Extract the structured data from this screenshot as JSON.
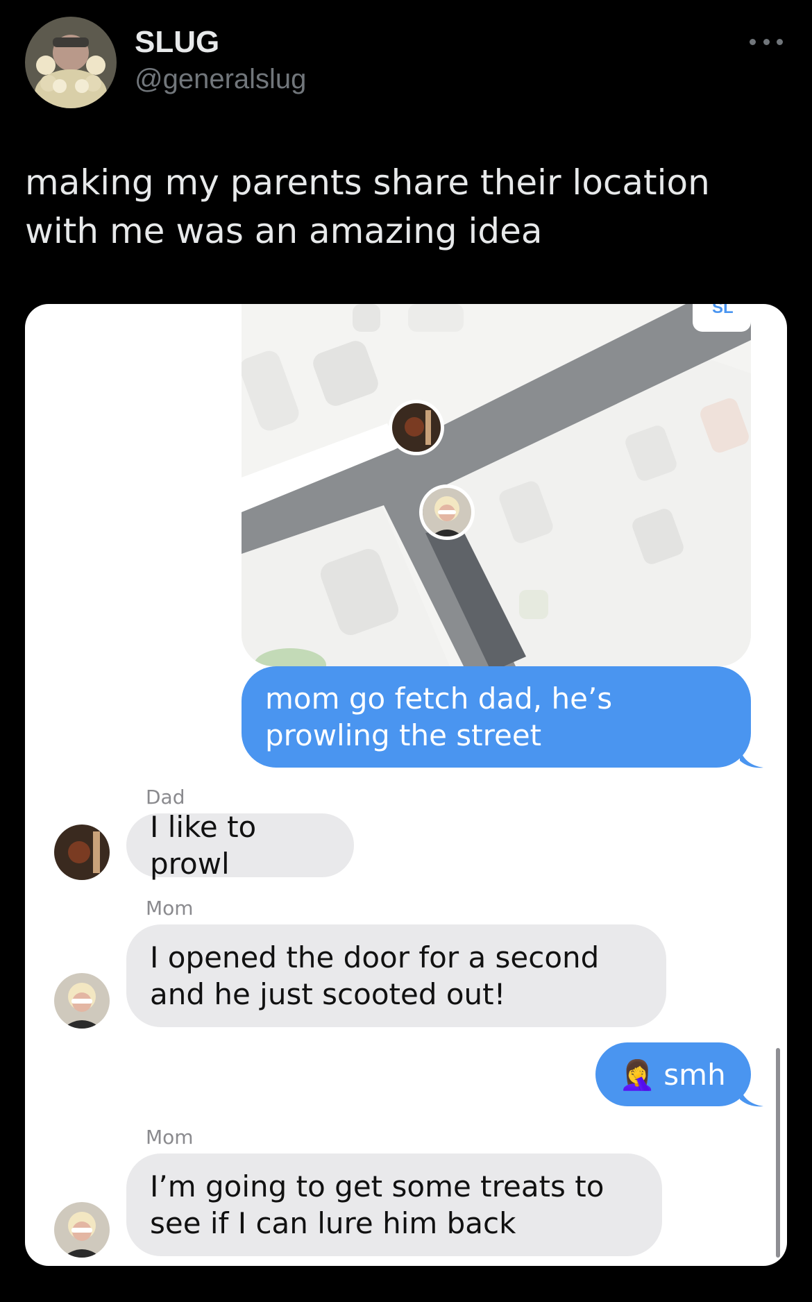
{
  "tweet": {
    "author_name": "SLUG",
    "author_handle": "@generalslug",
    "text": "making my parents share their location with me was an amazing idea",
    "more_icon": "more-horizontal-icon"
  },
  "map": {
    "corner_label": "SL"
  },
  "messages": [
    {
      "from": "me",
      "text": "mom go fetch dad, he’s prowling the street"
    },
    {
      "from": "Dad",
      "sender_label": "Dad",
      "text": "I like to prowl"
    },
    {
      "from": "Mom",
      "sender_label": "Mom",
      "text": "I opened the door for a second and he just scooted out!"
    },
    {
      "from": "me",
      "emoji": "🤦‍♀️",
      "text": "smh"
    },
    {
      "from": "Mom",
      "sender_label": "Mom",
      "text": "I’m going to get some treats to see if I can lure him back"
    }
  ],
  "colors": {
    "background": "#000000",
    "outgoing_bubble": "#4a95f0",
    "incoming_bubble": "#e9e9eb",
    "map_road": "#8a8d90",
    "map_block": "#e6e6e4"
  }
}
